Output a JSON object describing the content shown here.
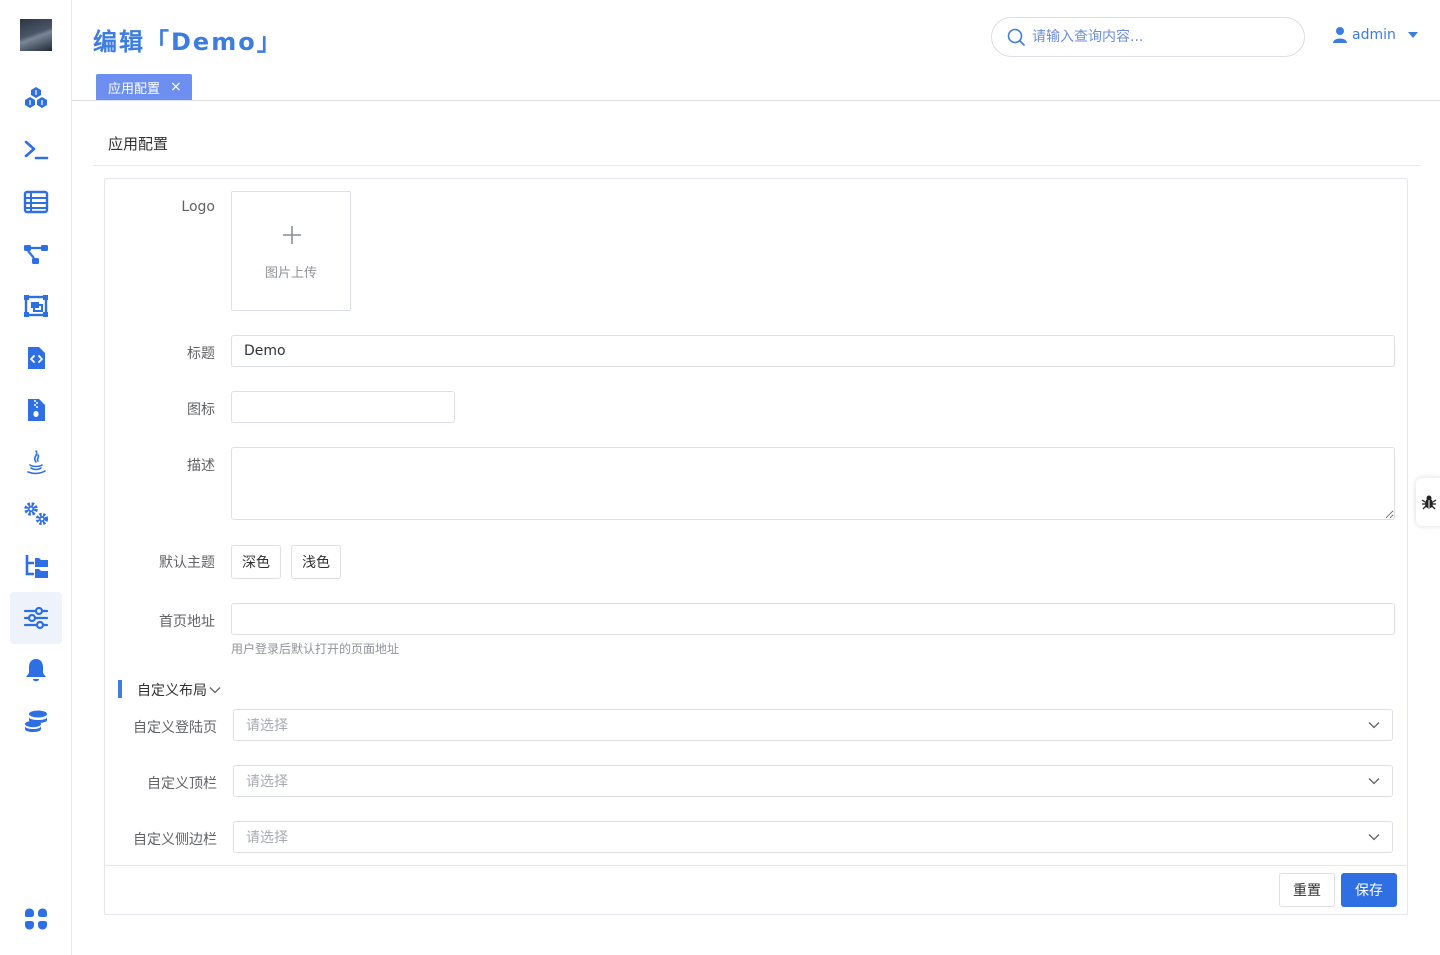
{
  "header": {
    "title": "编辑「Demo」",
    "search_placeholder": "请输入查询内容...",
    "username": "admin"
  },
  "sidebar": {
    "items": [
      {
        "icon": "cubes-icon"
      },
      {
        "icon": "terminal-icon"
      },
      {
        "icon": "list-icon"
      },
      {
        "icon": "flow-icon"
      },
      {
        "icon": "screen-icon"
      },
      {
        "icon": "code-file-icon"
      },
      {
        "icon": "zip-file-icon"
      },
      {
        "icon": "java-icon"
      },
      {
        "icon": "gears-icon"
      },
      {
        "icon": "folder-tree-icon"
      },
      {
        "icon": "sliders-icon",
        "active": true
      },
      {
        "icon": "bell-icon"
      },
      {
        "icon": "database-icon"
      },
      {
        "icon": "apps-icon"
      }
    ]
  },
  "tabs": [
    {
      "label": "应用配置",
      "close": "×"
    }
  ],
  "page": {
    "section_title": "应用配置"
  },
  "form": {
    "logo_label": "Logo",
    "upload_text": "图片上传",
    "title_label": "标题",
    "title_value": "Demo",
    "icon_label": "图标",
    "icon_value": "",
    "description_label": "描述",
    "description_value": "",
    "theme_label": "默认主题",
    "theme_dark": "深色",
    "theme_light": "浅色",
    "home_label": "首页地址",
    "home_value": "",
    "home_hint": "用户登录后默认打开的页面地址",
    "layout_group_title": "自定义布局",
    "login_page_label": "自定义登陆页",
    "topbar_label": "自定义顶栏",
    "sidebar_label": "自定义侧边栏",
    "select_placeholder": "请选择"
  },
  "actions": {
    "reset_label": "重置",
    "save_label": "保存"
  },
  "colors": {
    "accent": "#3d7de0",
    "primary_button": "#2f6fe4",
    "tab_bg": "#6d8ff0"
  }
}
